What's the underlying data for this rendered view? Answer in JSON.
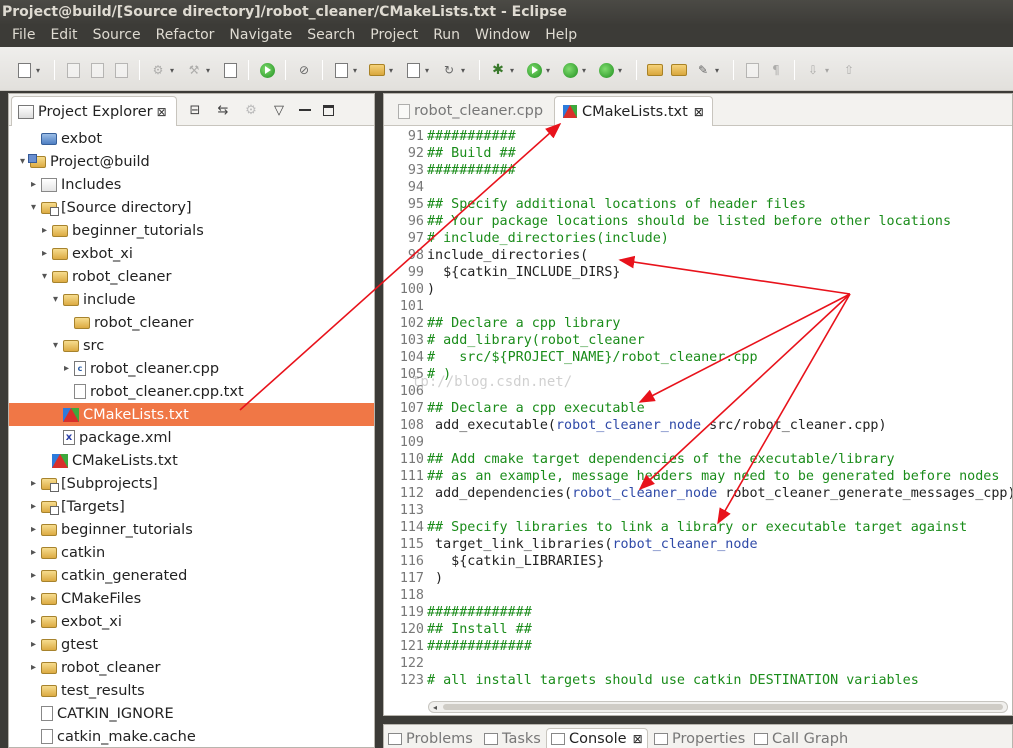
{
  "window": {
    "title": "Project@build/[Source directory]/robot_cleaner/CMakeLists.txt - Eclipse"
  },
  "menu": [
    "File",
    "Edit",
    "Source",
    "Refactor",
    "Navigate",
    "Search",
    "Project",
    "Run",
    "Window",
    "Help"
  ],
  "explorer": {
    "tab_label": "Project Explorer",
    "close_glyph": "⊠",
    "items": [
      {
        "label": "exbot",
        "depth": 1,
        "twisty": "",
        "icon": "project"
      },
      {
        "label": "Project@build",
        "depth": 0,
        "twisty": "▾",
        "icon": "projfolder"
      },
      {
        "label": "Includes",
        "depth": 1,
        "twisty": "▸",
        "icon": "includes"
      },
      {
        "label": "[Source directory]",
        "depth": 1,
        "twisty": "▾",
        "icon": "srcfolder"
      },
      {
        "label": "beginner_tutorials",
        "depth": 2,
        "twisty": "▸",
        "icon": "folder"
      },
      {
        "label": "exbot_xi",
        "depth": 2,
        "twisty": "▸",
        "icon": "folder"
      },
      {
        "label": "robot_cleaner",
        "depth": 2,
        "twisty": "▾",
        "icon": "folder"
      },
      {
        "label": "include",
        "depth": 3,
        "twisty": "▾",
        "icon": "folder"
      },
      {
        "label": "robot_cleaner",
        "depth": 4,
        "twisty": "",
        "icon": "folder"
      },
      {
        "label": "src",
        "depth": 3,
        "twisty": "▾",
        "icon": "folder"
      },
      {
        "label": "robot_cleaner.cpp",
        "depth": 4,
        "twisty": "▸",
        "icon": "cfile"
      },
      {
        "label": "robot_cleaner.cpp.txt",
        "depth": 4,
        "twisty": "",
        "icon": "file"
      },
      {
        "label": "CMakeLists.txt",
        "depth": 3,
        "twisty": "",
        "icon": "cmake",
        "selected": true
      },
      {
        "label": "package.xml",
        "depth": 3,
        "twisty": "",
        "icon": "xml"
      },
      {
        "label": "CMakeLists.txt",
        "depth": 2,
        "twisty": "",
        "icon": "cmake"
      },
      {
        "label": "[Subprojects]",
        "depth": 1,
        "twisty": "▸",
        "icon": "srcfolder"
      },
      {
        "label": "[Targets]",
        "depth": 1,
        "twisty": "▸",
        "icon": "srcfolder"
      },
      {
        "label": "beginner_tutorials",
        "depth": 1,
        "twisty": "▸",
        "icon": "folder"
      },
      {
        "label": "catkin",
        "depth": 1,
        "twisty": "▸",
        "icon": "folder"
      },
      {
        "label": "catkin_generated",
        "depth": 1,
        "twisty": "▸",
        "icon": "folder"
      },
      {
        "label": "CMakeFiles",
        "depth": 1,
        "twisty": "▸",
        "icon": "folder"
      },
      {
        "label": "exbot_xi",
        "depth": 1,
        "twisty": "▸",
        "icon": "folder"
      },
      {
        "label": "gtest",
        "depth": 1,
        "twisty": "▸",
        "icon": "folder"
      },
      {
        "label": "robot_cleaner",
        "depth": 1,
        "twisty": "▸",
        "icon": "folder"
      },
      {
        "label": "test_results",
        "depth": 1,
        "twisty": "",
        "icon": "folder"
      },
      {
        "label": "CATKIN_IGNORE",
        "depth": 1,
        "twisty": "",
        "icon": "file"
      },
      {
        "label": "catkin_make.cache",
        "depth": 1,
        "twisty": "",
        "icon": "file"
      }
    ]
  },
  "editor": {
    "tabs": [
      {
        "label": "robot_cleaner.cpp",
        "active": false
      },
      {
        "label": "CMakeLists.txt",
        "active": true,
        "close_glyph": "⊠"
      }
    ],
    "watermark": "tp://blog.csdn.net/",
    "lines": [
      {
        "n": "91",
        "parts": [
          {
            "t": "###########",
            "c": "cm"
          }
        ]
      },
      {
        "n": "92",
        "parts": [
          {
            "t": "## Build ##",
            "c": "cm"
          }
        ]
      },
      {
        "n": "93",
        "parts": [
          {
            "t": "###########",
            "c": "cm"
          }
        ]
      },
      {
        "n": "94",
        "parts": []
      },
      {
        "n": "95",
        "parts": [
          {
            "t": "## Specify additional locations of header files",
            "c": "cm"
          }
        ]
      },
      {
        "n": "96",
        "parts": [
          {
            "t": "## Your package locations should be listed before other locations",
            "c": "cm"
          }
        ]
      },
      {
        "n": "97",
        "parts": [
          {
            "t": "# include_directories(include)",
            "c": "cm"
          }
        ]
      },
      {
        "n": "98",
        "parts": [
          {
            "t": "include_directories(",
            "c": "ct"
          }
        ]
      },
      {
        "n": "99",
        "parts": [
          {
            "t": "  ${catkin_INCLUDE_DIRS}",
            "c": "ct"
          }
        ]
      },
      {
        "n": "100",
        "parts": [
          {
            "t": ")",
            "c": "ct"
          }
        ]
      },
      {
        "n": "101",
        "parts": []
      },
      {
        "n": "102",
        "parts": [
          {
            "t": "## Declare a cpp library",
            "c": "cm"
          }
        ]
      },
      {
        "n": "103",
        "parts": [
          {
            "t": "# add_library(robot_cleaner",
            "c": "cm"
          }
        ]
      },
      {
        "n": "104",
        "parts": [
          {
            "t": "#   src/${PROJECT_NAME}/robot_cleaner.cpp",
            "c": "cm"
          }
        ]
      },
      {
        "n": "105",
        "parts": [
          {
            "t": "# )",
            "c": "cm"
          }
        ]
      },
      {
        "n": "106",
        "parts": []
      },
      {
        "n": "107",
        "parts": [
          {
            "t": "## Declare a cpp executable",
            "c": "cm"
          }
        ]
      },
      {
        "n": "108",
        "parts": [
          {
            "t": " add_executable(",
            "c": "ct"
          },
          {
            "t": "robot_cleaner_node",
            "c": "vr"
          },
          {
            "t": " src/robot_cleaner.cpp)",
            "c": "ct"
          }
        ]
      },
      {
        "n": "109",
        "parts": []
      },
      {
        "n": "110",
        "parts": [
          {
            "t": "## Add cmake target dependencies of the executable/library",
            "c": "cm"
          }
        ]
      },
      {
        "n": "111",
        "parts": [
          {
            "t": "## as an example, message headers may need to be generated before nodes",
            "c": "cm"
          }
        ]
      },
      {
        "n": "112",
        "parts": [
          {
            "t": " add_dependencies(",
            "c": "ct"
          },
          {
            "t": "robot_cleaner_node",
            "c": "vr"
          },
          {
            "t": " robot_cleaner_generate_messages_cpp)",
            "c": "ct"
          }
        ]
      },
      {
        "n": "113",
        "parts": []
      },
      {
        "n": "114",
        "parts": [
          {
            "t": "## Specify libraries to link a library or executable target against",
            "c": "cm"
          }
        ]
      },
      {
        "n": "115",
        "parts": [
          {
            "t": " target_link_libraries(",
            "c": "ct"
          },
          {
            "t": "robot_cleaner_node",
            "c": "vr"
          }
        ]
      },
      {
        "n": "116",
        "parts": [
          {
            "t": "   ${catkin_LIBRARIES}",
            "c": "ct"
          }
        ]
      },
      {
        "n": "117",
        "parts": [
          {
            "t": " )",
            "c": "ct"
          }
        ]
      },
      {
        "n": "118",
        "parts": []
      },
      {
        "n": "119",
        "parts": [
          {
            "t": "#############",
            "c": "cm"
          }
        ]
      },
      {
        "n": "120",
        "parts": [
          {
            "t": "## Install ##",
            "c": "cm"
          }
        ]
      },
      {
        "n": "121",
        "parts": [
          {
            "t": "#############",
            "c": "cm"
          }
        ]
      },
      {
        "n": "122",
        "parts": []
      },
      {
        "n": "123",
        "parts": [
          {
            "t": "# all install targets should use catkin DESTINATION variables",
            "c": "cm"
          }
        ]
      }
    ]
  },
  "bottom": {
    "tabs": [
      {
        "label": "Problems",
        "active": false
      },
      {
        "label": "Tasks",
        "active": false
      },
      {
        "label": "Console",
        "active": true,
        "close_glyph": "⊠"
      },
      {
        "label": "Properties",
        "active": false
      },
      {
        "label": "Call Graph",
        "active": false
      }
    ]
  },
  "colors": {
    "selection": "#f07746",
    "arrow": "#e8121b",
    "comment": "#1a8c1a",
    "variable": "#2f4aa8"
  }
}
